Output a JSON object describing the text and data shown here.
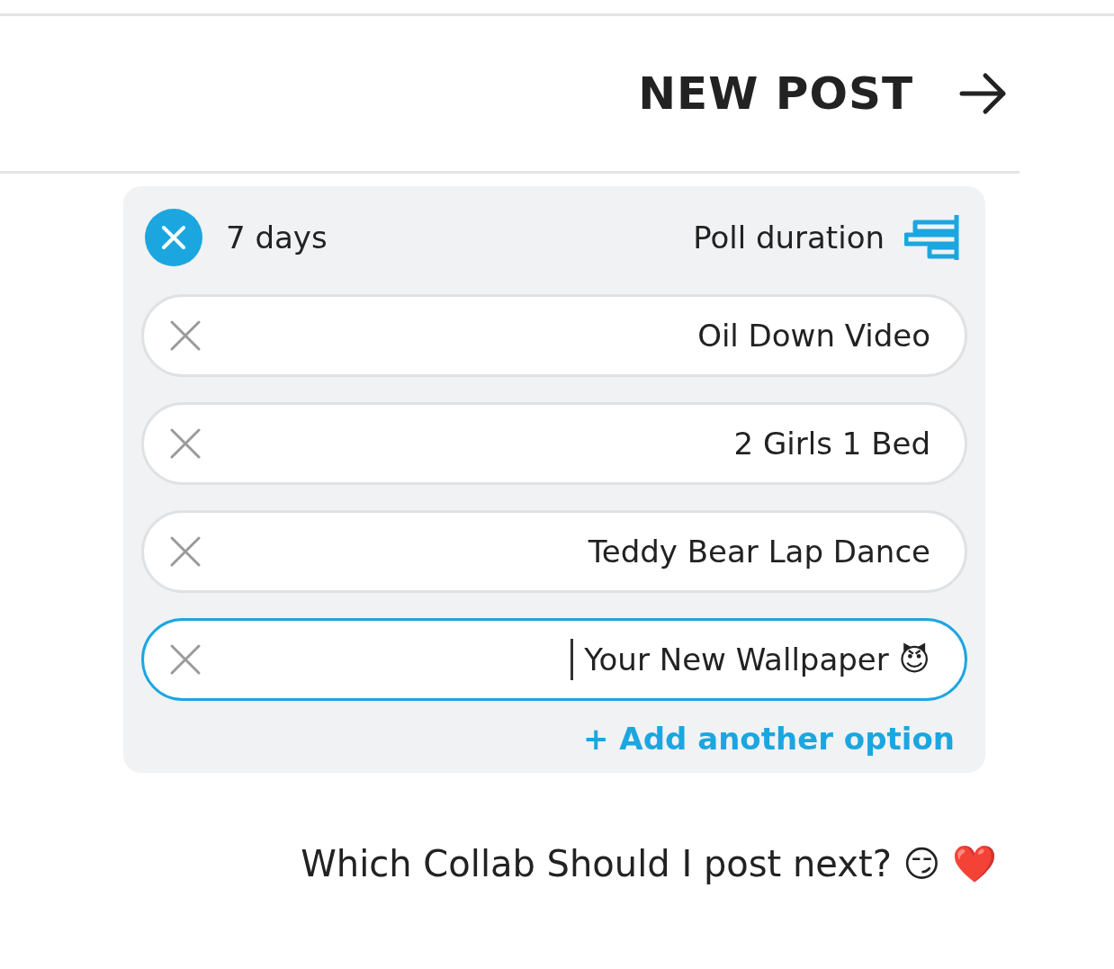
{
  "header": {
    "title": "NEW POST"
  },
  "poll": {
    "duration_label": "Poll duration",
    "duration_value": "7 days",
    "options": [
      {
        "value": "Oil Down Video",
        "focused": false
      },
      {
        "value": "2 Girls 1 Bed",
        "focused": false
      },
      {
        "value": "Teddy Bear Lap Dance",
        "focused": false
      },
      {
        "value": "Your New Wallpaper 😈",
        "focused": true
      }
    ],
    "add_option": "+ Add another option"
  },
  "caption": "Which Collab Should I post next? 😏 ❤️"
}
